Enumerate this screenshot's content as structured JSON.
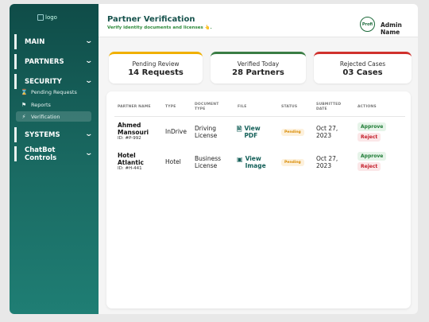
{
  "sidebar": {
    "logo_alt": "logo",
    "sections": [
      {
        "label": "MAIN",
        "chevron": "⌄"
      },
      {
        "label": "PARTNERS",
        "chevron": "⌄"
      },
      {
        "label": "SECURITY",
        "chevron": "⌄"
      },
      {
        "label": "SYSTEMS",
        "chevron": "⌄"
      },
      {
        "label": "ChatBot Controls",
        "chevron": "⌄"
      }
    ],
    "security_items": [
      {
        "label": "Pending Requests",
        "icon": "hourglass-icon"
      },
      {
        "label": "Reports",
        "icon": "flag-icon"
      },
      {
        "label": "Verification",
        "icon": "lightning-icon"
      }
    ]
  },
  "header": {
    "title": "Partner Verification",
    "subtitle": "Verify identity documents and licenses 👆.",
    "avatar_text": "Profi",
    "admin_name": "Admin Name"
  },
  "stats": [
    {
      "label": "Pending Review",
      "value": "14 Requests",
      "color": "#f0b000"
    },
    {
      "label": "Verified Today",
      "value": "28 Partners",
      "color": "#3a7d44"
    },
    {
      "label": "Rejected Cases",
      "value": "03 Cases",
      "color": "#d0312d"
    }
  ],
  "table": {
    "headers": {
      "name": "PARTNER NAME",
      "type": "TYPE",
      "doc1": "DOCUMENT",
      "doc2": "TYPE",
      "file": "FILE",
      "status": "STATUS",
      "date1": "SUBMITTED",
      "date2": "DATE",
      "actions": "ACTIONS"
    },
    "rows": [
      {
        "name1": "Ahmed",
        "name2": "Mansouri",
        "id": "ID: #P-992",
        "type": "InDrive",
        "doc1": "Driving",
        "doc2": "License",
        "file1": "View",
        "file2": "PDF",
        "file_icon": "document-icon",
        "status": "Pending",
        "date1": "Oct 27,",
        "date2": "2023",
        "approve": "Approve",
        "reject": "Reject"
      },
      {
        "name1": "Hotel",
        "name2": "Atlantic",
        "id": "ID: #H-441",
        "type": "Hotel",
        "doc1": "Business",
        "doc2": "License",
        "file1": "View",
        "file2": "Image",
        "file_icon": "image-icon",
        "status": "Pending",
        "date1": "Oct 27,",
        "date2": "2023",
        "approve": "Approve",
        "reject": "Reject"
      }
    ]
  }
}
